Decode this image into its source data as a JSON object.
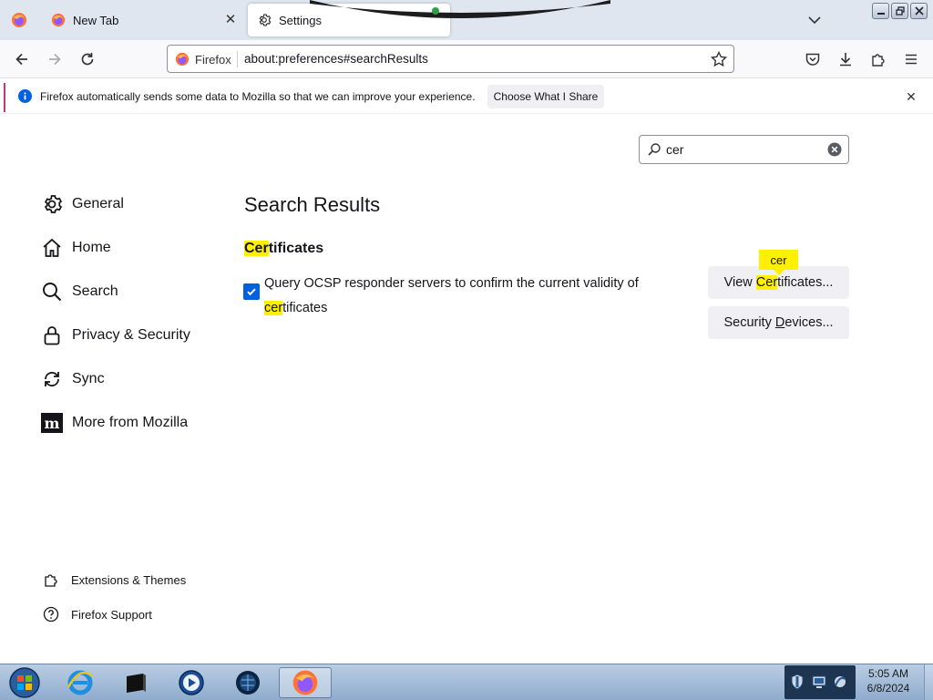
{
  "browser": {
    "tabs": [
      {
        "title": "New Tab",
        "active": false
      },
      {
        "title": "Settings",
        "active": true
      }
    ],
    "url_identity": "Firefox",
    "url": "about:preferences#searchResults"
  },
  "notice": {
    "text": "Firefox automatically sends some data to Mozilla so that we can improve your experience.",
    "button": "Choose What I Share"
  },
  "settings": {
    "search_value": "cer",
    "categories": [
      {
        "label": "General",
        "icon": "gear-icon"
      },
      {
        "label": "Home",
        "icon": "home-icon"
      },
      {
        "label": "Search",
        "icon": "search-icon"
      },
      {
        "label": "Privacy & Security",
        "icon": "lock-icon"
      },
      {
        "label": "Sync",
        "icon": "sync-icon"
      },
      {
        "label": "More from Mozilla",
        "icon": "mozilla-icon"
      }
    ],
    "footer_links": [
      {
        "label": "Extensions & Themes",
        "icon": "puzzle-icon"
      },
      {
        "label": "Firefox Support",
        "icon": "help-icon"
      }
    ],
    "results_title": "Search Results",
    "section": {
      "title_highlight": "Cer",
      "title_rest": "tificates",
      "ocsp_line1": "Query OCSP responder servers to confirm the current validity of",
      "ocsp_highlight": "cer",
      "ocsp_rest": "tificates",
      "ocsp_checked": true
    },
    "buttons": {
      "view_certs_prefix": "View ",
      "view_certs_highlight": "Cer",
      "view_certs_rest": "tificates...",
      "security_devices_prefix": "Security ",
      "security_devices_underline": "D",
      "security_devices_rest": "evices..."
    },
    "tooltip": "cer"
  },
  "taskbar": {
    "time": "5:05 AM",
    "date": "6/8/2024"
  },
  "colors": {
    "accent": "#0061e0",
    "highlight": "#fff000",
    "notice_accent": "#c1387c"
  }
}
